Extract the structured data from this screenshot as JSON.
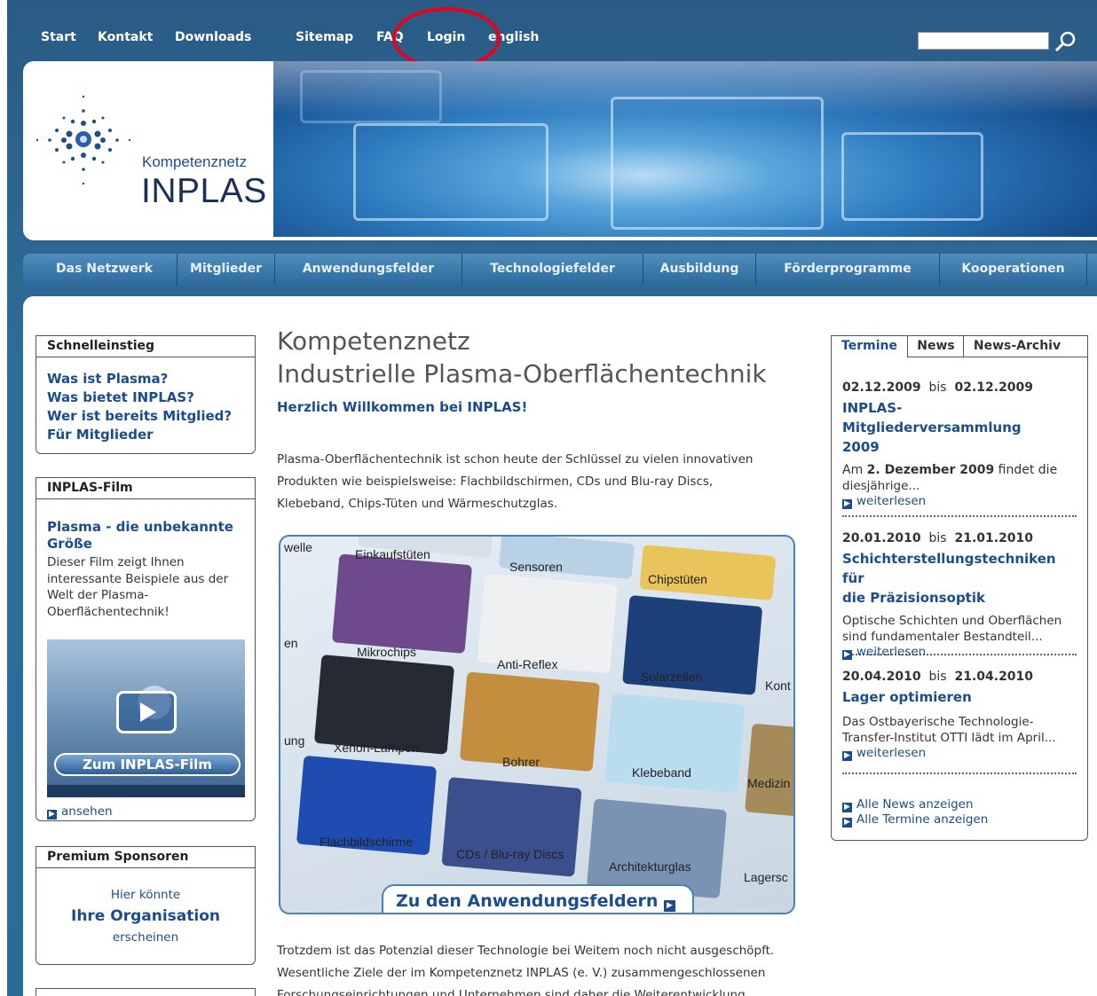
{
  "topnav": {
    "items": [
      "Start",
      "Kontakt",
      "Downloads",
      "Sitemap",
      "FAQ",
      "Login",
      "english"
    ]
  },
  "logo": {
    "line1": "Kompetenznetz",
    "line2": "INPLAS"
  },
  "mainnav": {
    "items": [
      "Das Netzwerk",
      "Mitglieder",
      "Anwendungsfelder",
      "Technologiefelder",
      "Ausbildung",
      "Förderprogramme",
      "Kooperationen"
    ]
  },
  "quick": {
    "title": "Schnelleinstieg",
    "links": [
      "Was ist Plasma?",
      "Was bietet INPLAS?",
      "Wer ist bereits Mitglied?",
      "Für Mitglieder"
    ]
  },
  "film": {
    "title": "INPLAS-Film",
    "link1": "Plasma - die unbekannte",
    "link2": "Größe",
    "desc1": "Dieser Film zeigt Ihnen",
    "desc2": "interessante Beispiele aus der",
    "desc3": "Welt der Plasma-",
    "desc4": "Oberflächentechnik!",
    "video_btn": "Zum INPLAS-Film",
    "watch": "ansehen"
  },
  "sponsors": {
    "title": "Premium Sponsoren",
    "l1": "Hier könnte",
    "l2": "Ihre Organisation",
    "l3": "erscheinen"
  },
  "main": {
    "title1": "Kompetenznetz",
    "title2": "Industrielle Plasma-Oberflächentechnik",
    "welcome": "Herzlich Willkommen bei INPLAS!",
    "p1a": "Plasma-Oberflächentechnik ist schon heute der Schlüssel zu vielen innovativen",
    "p1b": "Produkten wie beispielsweise: Flachbildschirmen, CDs und Blu-ray Discs,",
    "p1c": "Klebeband, Chips-Tüten und Wärmeschutzglas.",
    "p2a": "Trotzdem ist das Potenzial dieser Technologie bei Weitem noch nicht ausgeschöpft.",
    "p2b": "Wesentliche Ziele der im Kompetenznetz INPLAS (e. V.) zusammengeschlossenen",
    "p2c": "Forschungseinrichtungen und Unternehmen sind daher die Weiterentwicklung"
  },
  "collage": {
    "tiles": [
      "welle",
      "Einkaufstüten",
      "Sensoren",
      "Chipstüten",
      "en",
      "Mikrochips",
      "Anti-Reflex",
      "Solarzellen",
      "Kont",
      "ung",
      "Xenon-Lampen",
      "Bohrer",
      "Klebeband",
      "Medizin",
      "Flachbildschirme",
      "CDs / Blu-ray Discs",
      "Architekturglas",
      "Lagersc"
    ],
    "cta": "Zu den Anwendungsfeldern"
  },
  "news": {
    "tabs": [
      "Termine",
      "News",
      "News-Archiv"
    ],
    "bis": "bis",
    "items": [
      {
        "from": "02.12.2009",
        "to": "02.12.2009",
        "title1": "INPLAS-Mitgliederversammlung",
        "title2": "2009",
        "t1pre": "Am ",
        "t1b": "2. Dezember 2009",
        "t1post": " findet die",
        "t2": "diesjährige...",
        "more": "weiterlesen"
      },
      {
        "from": "20.01.2010",
        "to": "21.01.2010",
        "title1": "Schichterstellungstechniken für",
        "title2": "die Präzisionsoptik",
        "t1": "Optische Schichten und Oberflächen",
        "t2": "sind fundamentaler Bestandteil...",
        "more": "weiterlesen"
      },
      {
        "from": "20.04.2010",
        "to": "21.04.2010",
        "title1": "Lager optimieren",
        "t1": "Das Ostbayerische Technologie-",
        "t2": "Transfer-Institut OTTI lädt im April...",
        "more": "weiterlesen"
      }
    ],
    "all_news": "Alle News anzeigen",
    "all_dates": "Alle Termine anzeigen"
  },
  "colors": {
    "nav_blue": "#2c6a9c",
    "link_blue": "#1a4d8c",
    "annotation_red": "#e8001c"
  }
}
